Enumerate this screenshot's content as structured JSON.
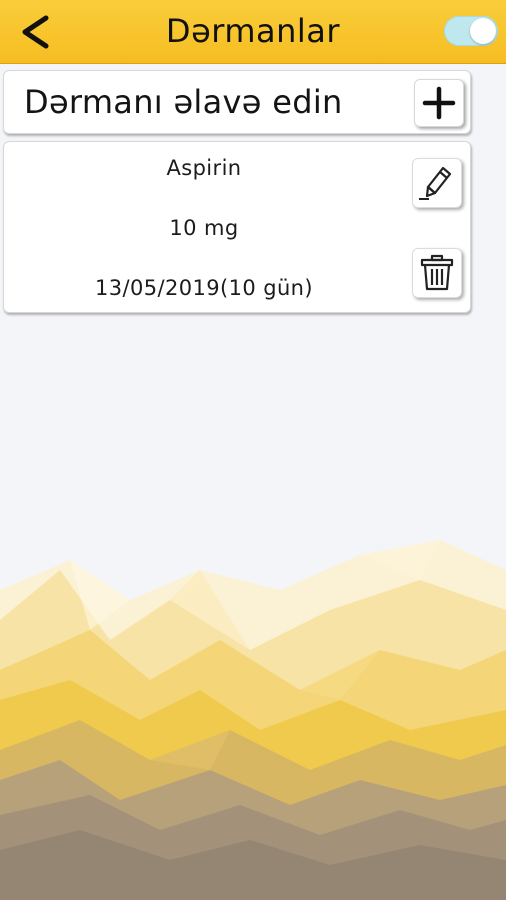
{
  "header": {
    "title": "Dərmanlar",
    "back_icon": "chevron-left-icon",
    "toggle_state": "on",
    "colors": {
      "bar": "#f8c42c",
      "toggle": "#bfe8ee"
    }
  },
  "add_row": {
    "label": "Dərmanı əlavə edin",
    "icon": "plus-icon"
  },
  "medicines": [
    {
      "name": "Aspirin",
      "dose": "10 mg",
      "date": "13/05/2019(10 gün)",
      "edit_icon": "pencil-icon",
      "delete_icon": "trash-icon"
    }
  ]
}
